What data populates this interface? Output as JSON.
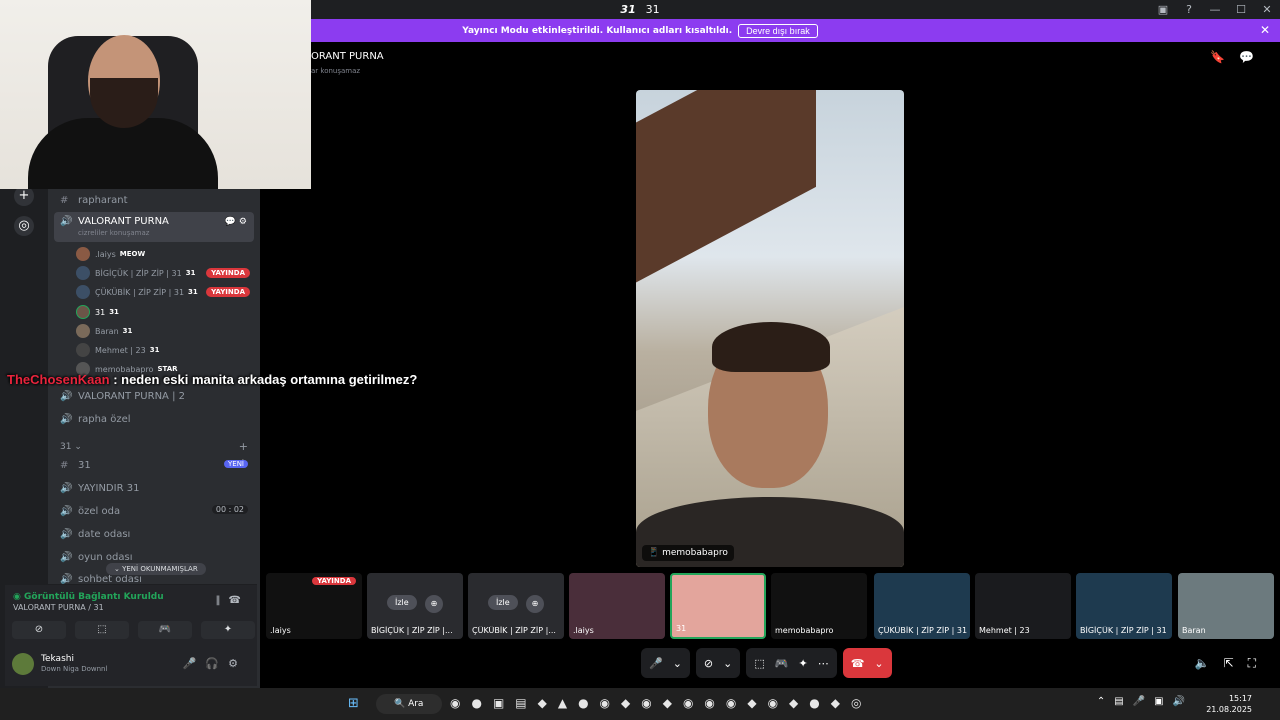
{
  "window": {
    "title_logo": "31",
    "title_name": "31",
    "icons": [
      "screen-icon",
      "help-icon",
      "minimize-icon",
      "maximize-icon",
      "close-icon"
    ]
  },
  "banner": {
    "text": "Yayıncı Modu etkinleştirildi. Kullanıcı adları kısaltıldı.",
    "button": "Devre dışı bırak",
    "close": "✕"
  },
  "sidebar": {
    "channels_top": [
      {
        "name": "rapharant",
        "icon": "#"
      }
    ],
    "active_channel": {
      "name": "VALORANT PURNA",
      "sub": "cizreliler konuşamaz"
    },
    "members": [
      {
        "name": ".laiys",
        "tag": "MEOW",
        "live": ""
      },
      {
        "name": "BİGİÇÜK | ZİP ZİP | 31",
        "tag": "31",
        "live": "YAYINDA"
      },
      {
        "name": "ÇÜKÜBİK | ZİP ZİP | 31",
        "tag": "31",
        "live": "YAYINDA"
      },
      {
        "name": "31",
        "tag": "31",
        "live": ""
      },
      {
        "name": "Baran",
        "tag": "31",
        "live": ""
      },
      {
        "name": "Mehmet | 23",
        "tag": "31",
        "live": ""
      },
      {
        "name": "memobabapro",
        "tag": "STAR",
        "live": ""
      }
    ],
    "channels_mid": [
      {
        "name": "VALORANT PURNA | 2"
      },
      {
        "name": "rapha özel"
      }
    ],
    "category": "31",
    "channels_cat": [
      {
        "name": "31",
        "badge": "YENİ"
      },
      {
        "name": "YAYINDIR 31"
      },
      {
        "name": "özel oda",
        "timer": "00 : 02"
      },
      {
        "name": "date odası"
      },
      {
        "name": "oyun odası"
      },
      {
        "name": "sohbet odası"
      }
    ],
    "unread": "YENİ OKUNMAMIŞLAR"
  },
  "voice": {
    "status": "Görüntülü Bağlantı Kuruldu",
    "location": "VALORANT PURNA / 31"
  },
  "user": {
    "name": "Tekashi",
    "status": "Down Niga Downnl"
  },
  "channel_header": {
    "title": "ORANT PURNA",
    "sub": "ar konuşamaz"
  },
  "stage": {
    "name": "memobabapro"
  },
  "chat_overlay": {
    "user": "TheChosenKaan",
    "message": " : neden eski manita arkadaş ortamına getirilmez?"
  },
  "thumbnails": [
    {
      "label": ".laiys",
      "live": "YAYINDA"
    },
    {
      "label": "BİGİÇÜK | ZİP ZİP |...",
      "watch": "İzle"
    },
    {
      "label": "ÇÜKÜBİK | ZİP ZİP |...",
      "watch": "İzle"
    },
    {
      "label": ".laiys"
    },
    {
      "label": "31"
    },
    {
      "label": "memobabapro"
    },
    {
      "label": "ÇÜKÜBİK | ZİP ZİP | 31"
    },
    {
      "label": "Mehmet | 23"
    },
    {
      "label": "BİGİÇÜK | ZİP ZİP | 31"
    },
    {
      "label": "Baran"
    }
  ],
  "taskbar": {
    "search": "Ara",
    "time": "15:17",
    "date": "21.08.2025"
  },
  "colors": {
    "accent": "#8c3cf0",
    "live": "#da373c",
    "online": "#23a55a",
    "new": "#5865f2"
  }
}
